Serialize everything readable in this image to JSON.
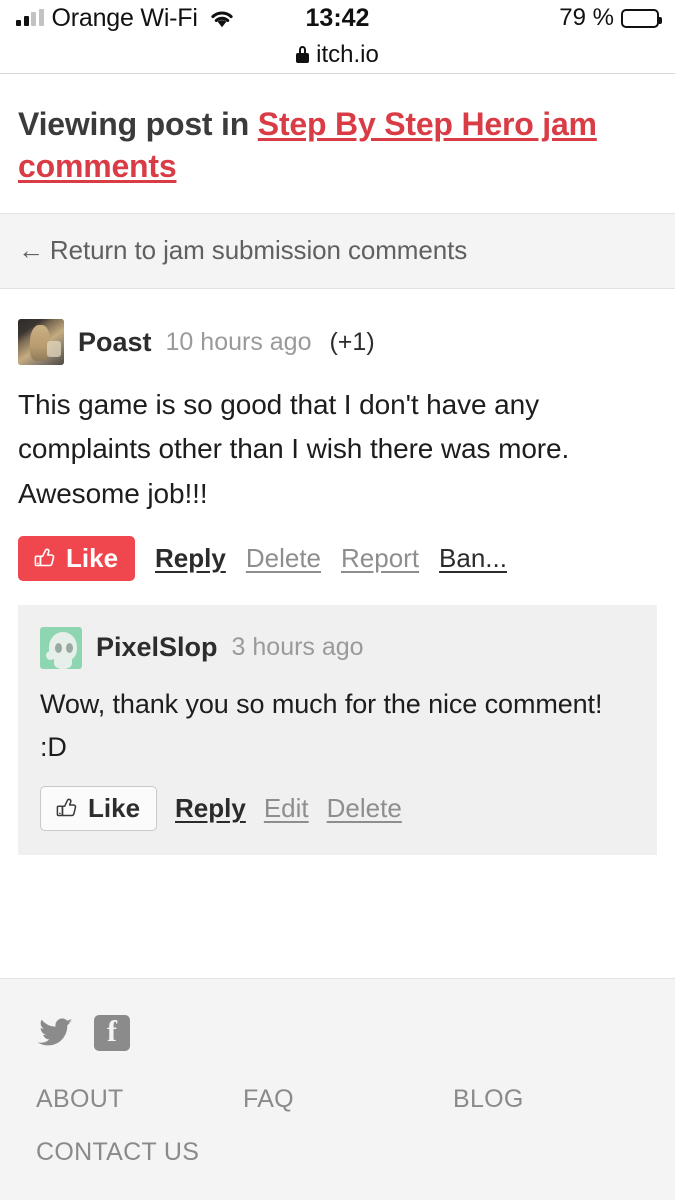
{
  "statusbar": {
    "carrier": "Orange Wi-Fi",
    "time": "13:42",
    "battery_percent": "79 %",
    "signal_icon": "signal-bars-icon",
    "wifi_icon": "wifi-icon",
    "battery_icon": "battery-icon",
    "battery_level": 79
  },
  "urlbar": {
    "lock_icon": "lock-icon",
    "url": "itch.io"
  },
  "header": {
    "title_prefix": "Viewing post in ",
    "title_link": "Step By Step Hero jam comments"
  },
  "nav": {
    "return_arrow": "←",
    "return_label": "Return to jam submission comments"
  },
  "comments": [
    {
      "author": "Poast",
      "time": "10 hours ago",
      "score": "(+1)",
      "avatar_icon": "dog-photo-avatar",
      "body": "This game is so good that I don't have any complaints other than I wish there was more. Awesome job!!!",
      "like": {
        "label": "Like",
        "icon": "thumbs-up-icon",
        "active": true
      },
      "actions": [
        {
          "label": "Reply",
          "style": "strong"
        },
        {
          "label": "Delete",
          "style": "muted"
        },
        {
          "label": "Report",
          "style": "muted"
        },
        {
          "label": "Ban...",
          "style": "dark"
        }
      ],
      "reply": {
        "author": "PixelSlop",
        "time": "3 hours ago",
        "avatar_icon": "skull-avatar",
        "body": "Wow, thank you so much for the nice comment! :D",
        "like": {
          "label": "Like",
          "icon": "thumbs-up-icon",
          "active": false
        },
        "actions": [
          {
            "label": "Reply",
            "style": "strong"
          },
          {
            "label": "Edit",
            "style": "muted"
          },
          {
            "label": "Delete",
            "style": "muted"
          }
        ]
      }
    }
  ],
  "footer": {
    "twitter_icon": "twitter-icon",
    "facebook_icon": "facebook-icon",
    "links": [
      "ABOUT",
      "FAQ",
      "BLOG"
    ],
    "links_row2": [
      "CONTACT US"
    ]
  },
  "colors": {
    "accent_red": "#da3c46",
    "like_red": "#f0474f",
    "reply_bg": "#f0f0f0",
    "footer_bg": "#f4f4f4",
    "avatar_green": "#8ed6b1"
  }
}
